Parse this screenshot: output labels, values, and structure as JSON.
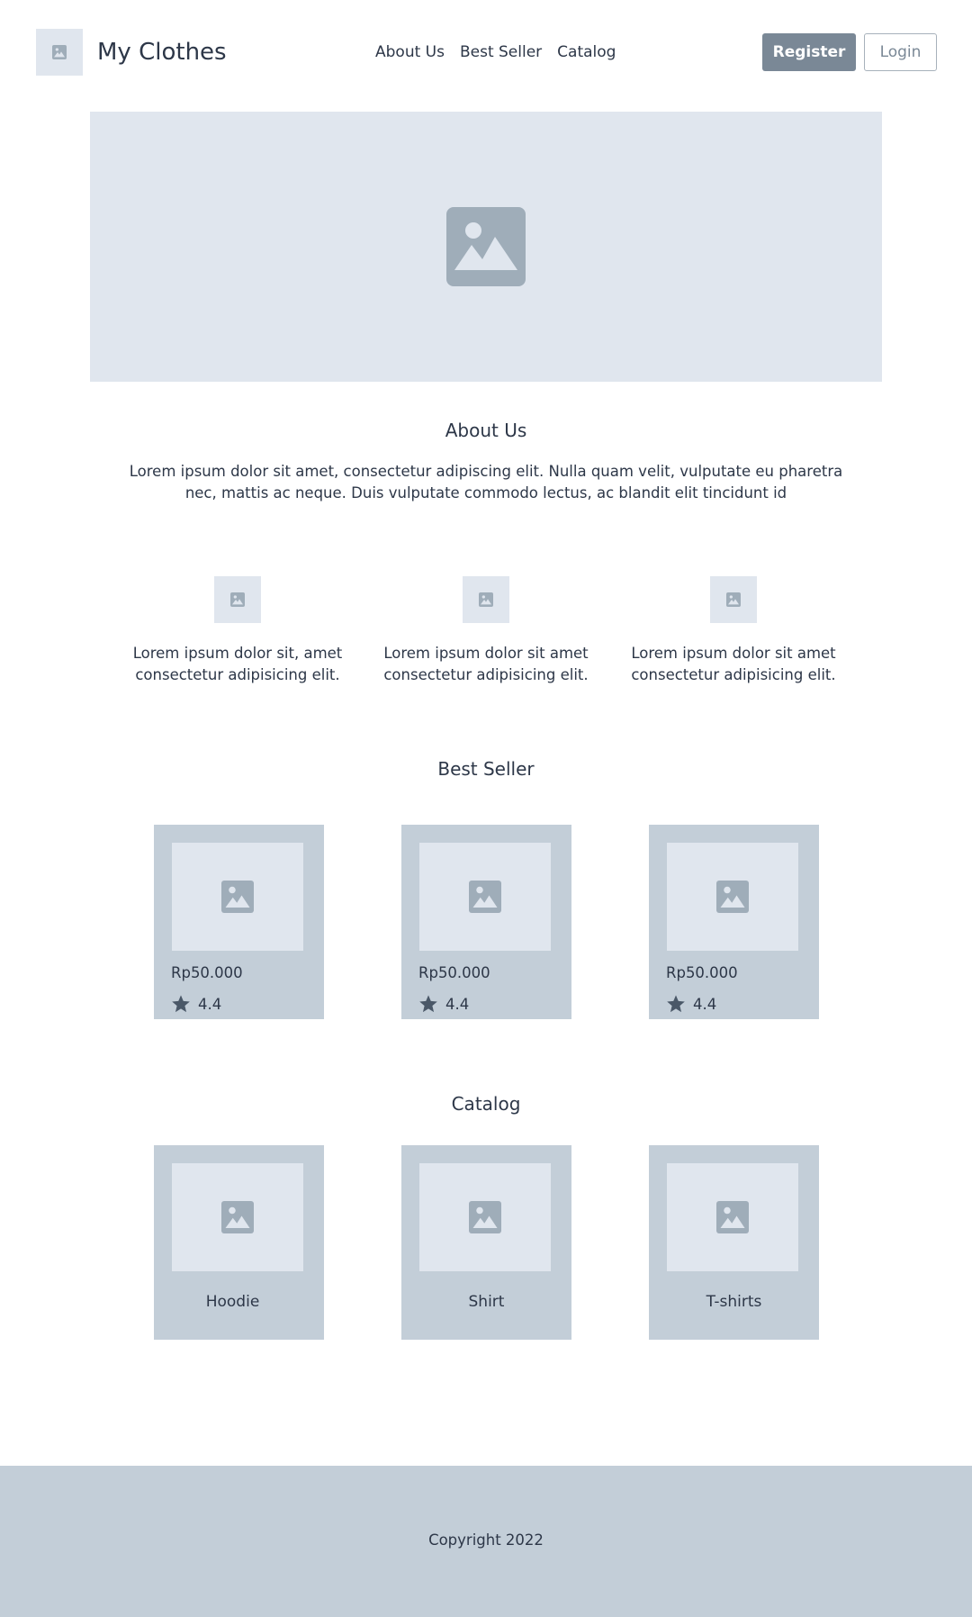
{
  "header": {
    "logo_icon": "image-placeholder-icon",
    "brand": "My Clothes",
    "nav": [
      "About Us",
      "Best Seller",
      "Catalog"
    ],
    "register_label": "Register",
    "login_label": "Login"
  },
  "hero": {
    "icon": "image-placeholder-icon"
  },
  "about": {
    "title": "About Us",
    "text": "Lorem ipsum dolor sit amet, consectetur adipiscing elit. Nulla quam velit, vulputate eu pharetra nec, mattis ac neque. Duis vulputate commodo lectus, ac blandit elit tincidunt id",
    "features": [
      {
        "line1": "Lorem ipsum dolor sit, amet",
        "line2": "consectetur adipisicing elit."
      },
      {
        "line1": "Lorem ipsum dolor sit amet",
        "line2": "consectetur adipisicing elit."
      },
      {
        "line1": "Lorem ipsum dolor sit amet",
        "line2": "consectetur adipisicing elit."
      }
    ]
  },
  "best_seller": {
    "title": "Best Seller",
    "items": [
      {
        "price": "Rp50.000",
        "rating": "4.4"
      },
      {
        "price": "Rp50.000",
        "rating": "4.4"
      },
      {
        "price": "Rp50.000",
        "rating": "4.4"
      }
    ]
  },
  "catalog": {
    "title": "Catalog",
    "items": [
      {
        "label": "Hoodie"
      },
      {
        "label": "Shirt"
      },
      {
        "label": "T-shirts"
      }
    ]
  },
  "footer": {
    "copyright": "Copyright 2022"
  },
  "colors": {
    "placeholder_bg": "#e0e6ee",
    "card_bg": "#c3ced8",
    "icon_gray": "#9fadb9",
    "register_bg": "#7a8896",
    "text": "#2d3748",
    "star": "#4a5868"
  }
}
